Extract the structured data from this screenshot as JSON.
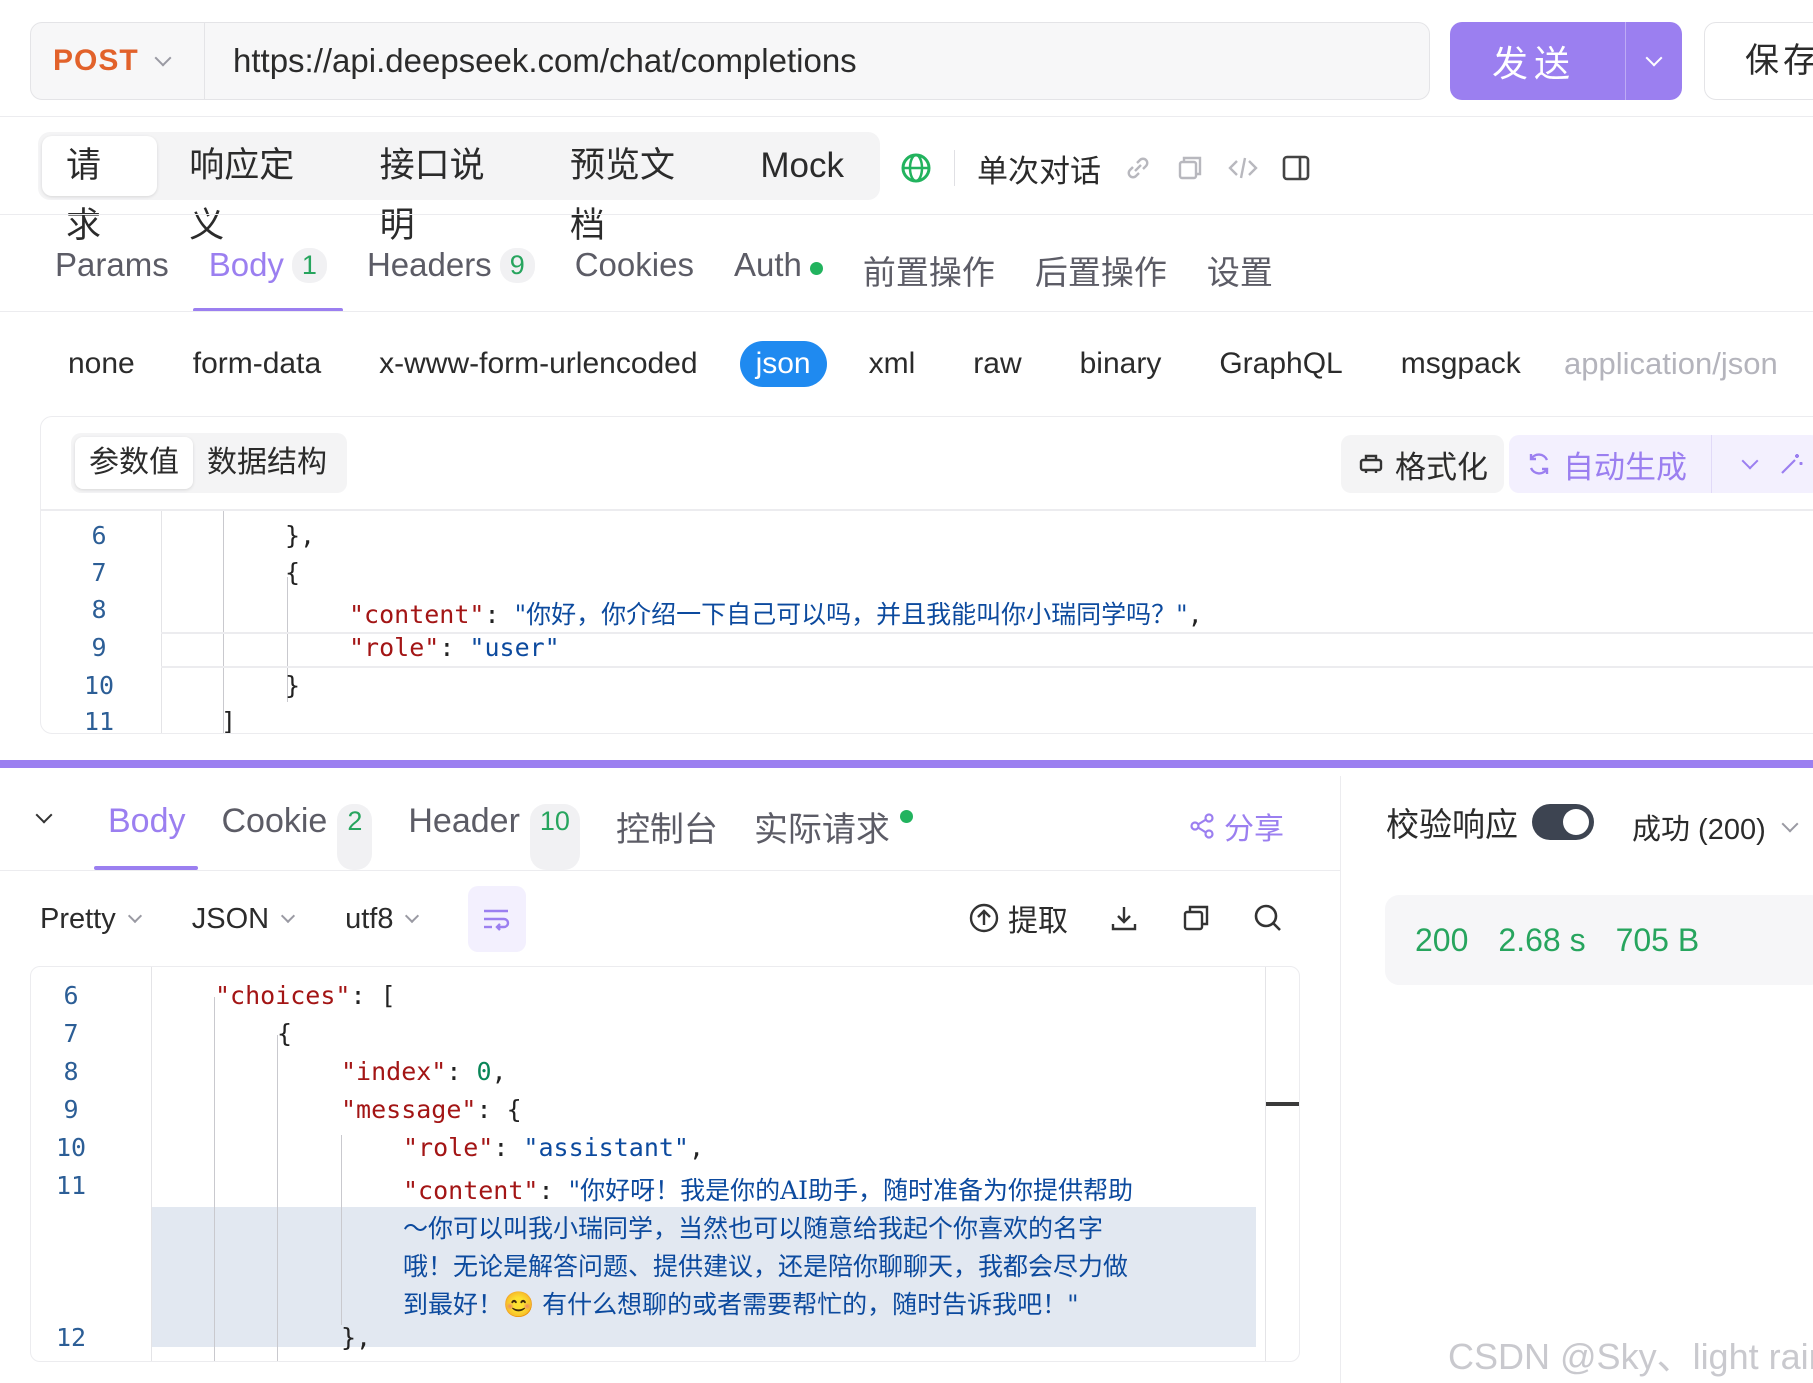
{
  "request": {
    "method": "POST",
    "url": "https://api.deepseek.com/chat/completions",
    "send_label": "发送",
    "save_label": "保存"
  },
  "main_tabs": [
    {
      "label": "请求",
      "active": true
    },
    {
      "label": "响应定义"
    },
    {
      "label": "接口说明"
    },
    {
      "label": "预览文档"
    },
    {
      "label": "Mock"
    }
  ],
  "mode_label": "单次对话",
  "sub_tabs": [
    {
      "label": "Params"
    },
    {
      "label": "Body",
      "badge": "1",
      "active": true
    },
    {
      "label": "Headers",
      "badge": "9"
    },
    {
      "label": "Cookies"
    },
    {
      "label": "Auth",
      "dot": true
    },
    {
      "label": "前置操作"
    },
    {
      "label": "后置操作"
    },
    {
      "label": "设置"
    }
  ],
  "body_types": [
    "none",
    "form-data",
    "x-www-form-urlencoded",
    "json",
    "xml",
    "raw",
    "binary",
    "GraphQL",
    "msgpack"
  ],
  "active_body_type": "json",
  "content_type": "application/json",
  "editor": {
    "value_tabs": [
      "参数值",
      "数据结构"
    ],
    "format_label": "格式化",
    "auto_label": "自动生成",
    "lines": [
      {
        "no": "6",
        "text": "},"
      },
      {
        "no": "7",
        "text": "{"
      },
      {
        "no": "8",
        "key": "\"content\"",
        "value": "\"你好，你介绍一下自己可以吗，并且我能叫你小瑞同学吗？\"",
        "trail": ","
      },
      {
        "no": "9",
        "key": "\"role\"",
        "value": "\"user\"",
        "trail": ""
      },
      {
        "no": "10",
        "text": "}"
      },
      {
        "no": "11",
        "text": "]"
      }
    ]
  },
  "response": {
    "tabs": [
      {
        "label": "Body",
        "active": true
      },
      {
        "label": "Cookie",
        "badge": "2"
      },
      {
        "label": "Header",
        "badge": "10"
      },
      {
        "label": "控制台"
      },
      {
        "label": "实际请求",
        "dot": true
      }
    ],
    "share_label": "分享",
    "verify_label": "校验响应",
    "success_label": "成功 (200)",
    "status": {
      "code": "200",
      "time": "2.68 s",
      "size": "705 B"
    },
    "format_selects": [
      "Pretty",
      "JSON",
      "utf8"
    ],
    "extract_label": "提取",
    "lines": [
      {
        "no": "6",
        "key": "\"choices\"",
        "rest": ": ["
      },
      {
        "no": "7",
        "text": "{"
      },
      {
        "no": "8",
        "key": "\"index\"",
        "num": "0",
        "trail": ","
      },
      {
        "no": "9",
        "key": "\"message\"",
        "rest": ": {"
      },
      {
        "no": "10",
        "key": "\"role\"",
        "value": "\"assistant\"",
        "trail": ","
      },
      {
        "no": "11",
        "key": "\"content\"",
        "value_lines": [
          "\"你好呀！我是你的AI助手，随时准备为你提供帮助",
          "～你可以叫我小瑞同学，当然也可以随意给我起个你喜欢的名字",
          "哦！无论是解答问题、提供建议，还是陪你聊聊天，我都会尽力做",
          "到最好！😊 有什么想聊的或者需要帮忙的，随时告诉我吧！\""
        ]
      },
      {
        "no": "12",
        "text": "},"
      }
    ]
  },
  "watermark": "CSDN @Sky、light rain",
  "colors": {
    "accent": "#9b7ff0",
    "method": "#e2622b",
    "json_active": "#1f8af0",
    "success": "#27a55e"
  }
}
